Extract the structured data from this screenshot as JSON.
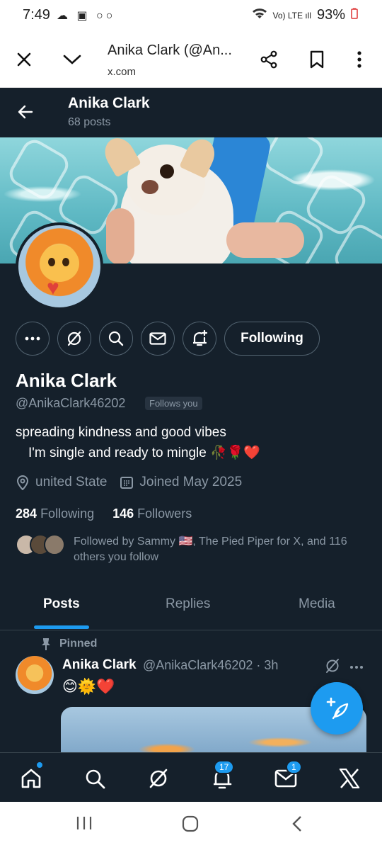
{
  "status_bar": {
    "time": "7:49",
    "battery": "93%"
  },
  "browser": {
    "title": "Anika Clark (@An...",
    "url": "x.com"
  },
  "header": {
    "name": "Anika Clark",
    "posts": "68 posts"
  },
  "profile": {
    "name": "Anika Clark",
    "handle": "@AnikaClark46202",
    "follows_you": "Follows you",
    "bio_line1": "spreading kindness and good vibes",
    "bio_line2": "I'm single and ready to mingle",
    "bio_emojis": "🥀🌹❤️",
    "location": "united State",
    "joined": "Joined May 2025",
    "following_count": "284",
    "following_label": "Following",
    "followers_count": "146",
    "followers_label": "Followers",
    "followed_by": "Followed by Sammy 🇺🇸, The Pied Piper for X, and 116 others you follow",
    "following_button": "Following"
  },
  "tabs": [
    {
      "label": "Posts",
      "active": true
    },
    {
      "label": "Replies",
      "active": false
    },
    {
      "label": "Media",
      "active": false
    }
  ],
  "pinned_post": {
    "pinned_label": "Pinned",
    "author": "Anika Clark",
    "handle_time": "@AnikaClark46202 · 3h",
    "text": "😊🌞❤️"
  },
  "bottom_nav": {
    "notifications_badge": "17",
    "messages_badge": "1"
  },
  "colors": {
    "accent": "#1d9bf0",
    "background": "#15202b",
    "muted": "#8b98a5"
  },
  "icons": [
    "close-icon",
    "chevron-down-icon",
    "share-icon",
    "bookmark-icon",
    "more-vertical-icon",
    "back-arrow-icon",
    "more-icon",
    "grok-icon",
    "search-icon",
    "mail-icon",
    "bell-plus-icon",
    "location-icon",
    "calendar-icon",
    "pin-icon",
    "compose-icon",
    "home-icon",
    "bell-icon",
    "x-logo-icon"
  ]
}
